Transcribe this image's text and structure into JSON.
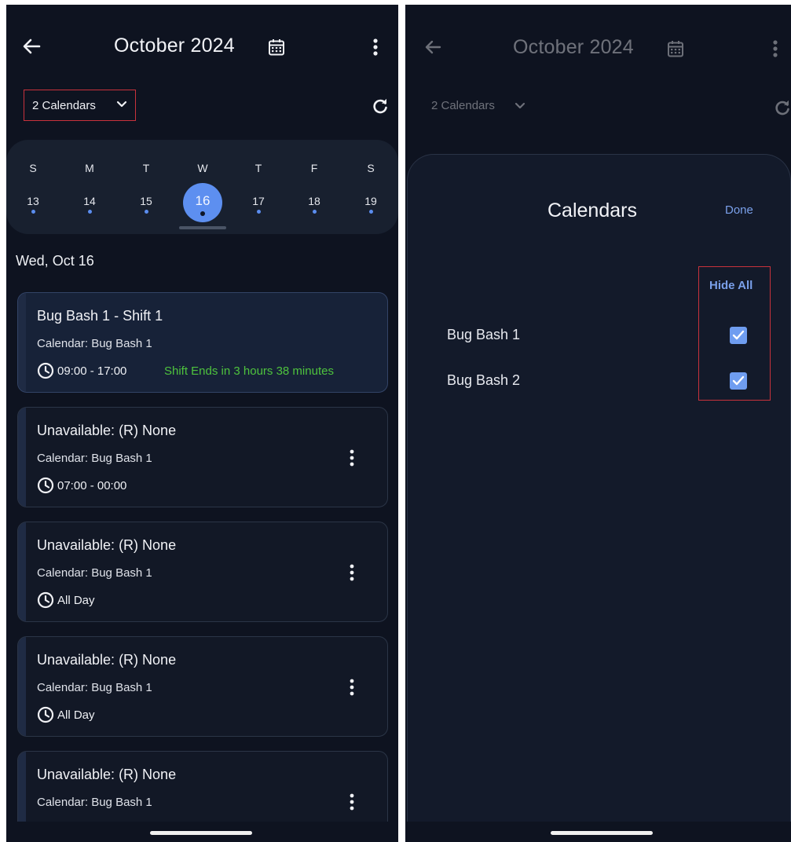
{
  "colors": {
    "background": "#0e1320",
    "accent": "#5d8ff0",
    "link": "#7aa0ea",
    "success_text": "#4ec33d",
    "highlight_box": "#c8323c"
  },
  "left_screen": {
    "header": {
      "back_icon": "arrow-left-icon",
      "title": "October 2024",
      "calendar_icon": "calendar-icon",
      "menu_icon": "more-vertical-icon"
    },
    "calendar_selector": {
      "label": "2 Calendars",
      "icon": "chevron-down-icon"
    },
    "refresh_icon": "refresh-icon",
    "week": {
      "days": [
        {
          "dow": "S",
          "num": "13",
          "has_events": true,
          "selected": false
        },
        {
          "dow": "M",
          "num": "14",
          "has_events": true,
          "selected": false
        },
        {
          "dow": "T",
          "num": "15",
          "has_events": true,
          "selected": false
        },
        {
          "dow": "W",
          "num": "16",
          "has_events": true,
          "selected": true
        },
        {
          "dow": "T",
          "num": "17",
          "has_events": true,
          "selected": false
        },
        {
          "dow": "F",
          "num": "18",
          "has_events": true,
          "selected": false
        },
        {
          "dow": "S",
          "num": "19",
          "has_events": true,
          "selected": false
        }
      ]
    },
    "date_heading": "Wed, Oct 16",
    "events": [
      {
        "title": "Bug Bash 1 - Shift 1",
        "calendar": "Calendar: Bug Bash 1",
        "time": "09:00 - 17:00",
        "status": "Shift Ends in 3 hours 38 minutes"
      },
      {
        "title": "Unavailable: (R) None",
        "calendar": "Calendar: Bug Bash 1",
        "time": "07:00 - 00:00"
      },
      {
        "title": "Unavailable: (R) None",
        "calendar": "Calendar: Bug Bash 1",
        "time": "All Day"
      },
      {
        "title": "Unavailable: (R) None",
        "calendar": "Calendar: Bug Bash 1",
        "time": "All Day"
      },
      {
        "title": "Unavailable: (R) None",
        "calendar": "Calendar: Bug Bash 1"
      }
    ]
  },
  "right_screen": {
    "header": {
      "back_icon": "arrow-left-icon",
      "title": "October 2024",
      "calendar_icon": "calendar-icon",
      "menu_icon": "more-vertical-icon"
    },
    "calendar_selector": {
      "label": "2 Calendars",
      "icon": "chevron-down-icon"
    },
    "refresh_icon": "refresh-icon",
    "sheet": {
      "title": "Calendars",
      "done_label": "Done",
      "hide_all_label": "Hide All",
      "calendars": [
        {
          "name": "Bug Bash 1",
          "checked": true
        },
        {
          "name": "Bug Bash 2",
          "checked": true
        }
      ]
    }
  }
}
